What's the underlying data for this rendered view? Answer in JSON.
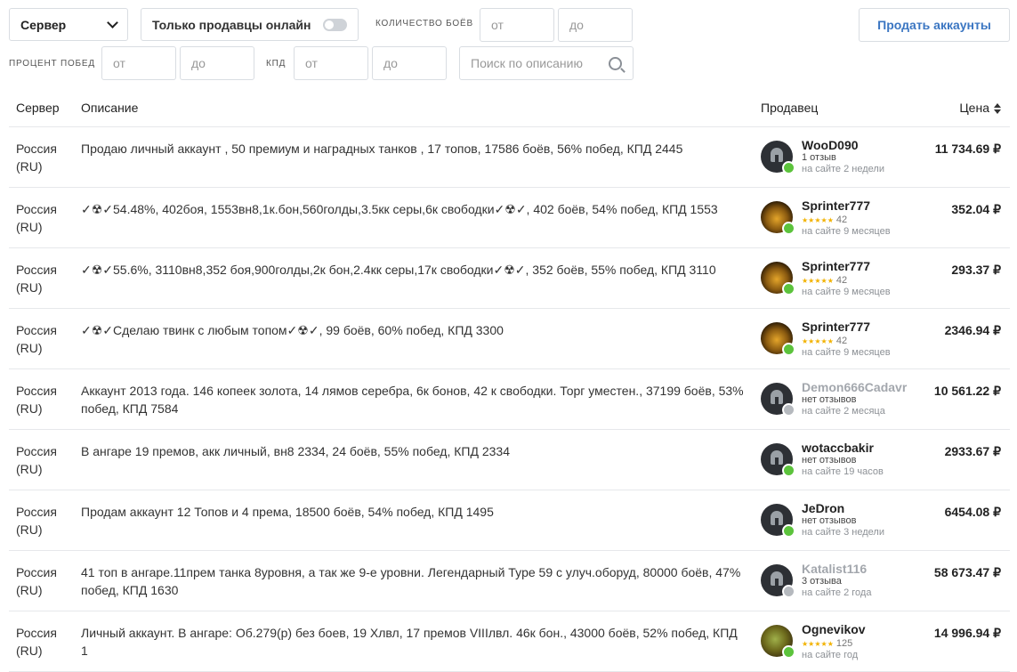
{
  "filters": {
    "server_select": "Сервер",
    "online_only": "Только продавцы онлайн",
    "battles_label": "КОЛИЧЕСТВО БОЁВ",
    "winrate_label": "ПРОЦЕНТ ПОБЕД",
    "kpd_label": "КПД",
    "from_placeholder": "от",
    "to_placeholder": "до",
    "search_placeholder": "Поиск по описанию",
    "sell_button": "Продать аккаунты"
  },
  "table": {
    "headers": {
      "server": "Сервер",
      "description": "Описание",
      "seller": "Продавец",
      "price": "Цена"
    },
    "rows": [
      {
        "server": "Россия (RU)",
        "description": "Продаю личный аккаунт , 50 премиум и наградных танков , 17 топов, 17586 боёв, 56% побед, КПД 2445",
        "seller": "WooD090",
        "reviews": "1 отзыв",
        "seen": "на сайте 2 недели",
        "price": "11 734.69 ₽"
      },
      {
        "server": "Россия (RU)",
        "description": "✓☢✓54.48%, 402боя, 1553вн8,1к.бон,560голды,3.5кк серы,6к свободки✓☢✓, 402 боёв, 54% побед, КПД 1553",
        "seller": "Sprinter777",
        "stars": "★★★★★",
        "rating": "42",
        "seen": "на сайте 9 месяцев",
        "price": "352.04 ₽"
      },
      {
        "server": "Россия (RU)",
        "description": "✓☢✓55.6%, 3110вн8,352 боя,900голды,2к бон,2.4кк серы,17к свободки✓☢✓, 352 боёв, 55% побед, КПД 3110",
        "seller": "Sprinter777",
        "stars": "★★★★★",
        "rating": "42",
        "seen": "на сайте 9 месяцев",
        "price": "293.37 ₽"
      },
      {
        "server": "Россия (RU)",
        "description": "✓☢✓Сделаю твинк с любым топом✓☢✓, 99 боёв, 60% побед, КПД 3300",
        "seller": "Sprinter777",
        "stars": "★★★★★",
        "rating": "42",
        "seen": "на сайте 9 месяцев",
        "price": "2346.94 ₽"
      },
      {
        "server": "Россия (RU)",
        "description": "Аккаунт 2013 года. 146 копеек золота, 14 лямов серебра, 6к бонов, 42 к свободки. Торг уместен., 37199 боёв, 53% побед, КПД 7584",
        "seller": "Demon666Cadavr",
        "reviews": "нет отзывов",
        "seen": "на сайте 2 месяца",
        "price": "10 561.22 ₽"
      },
      {
        "server": "Россия (RU)",
        "description": "В ангаре 19 премов, акк личный, вн8 2334, 24 боёв, 55% побед, КПД 2334",
        "seller": "wotaccbakir",
        "reviews": "нет отзывов",
        "seen": "на сайте 19 часов",
        "price": "2933.67 ₽"
      },
      {
        "server": "Россия (RU)",
        "description": "Продам аккаунт 12 Топов и 4 према, 18500 боёв, 54% побед, КПД 1495",
        "seller": "JeDron",
        "reviews": "нет отзывов",
        "seen": "на сайте 3 недели",
        "price": "6454.08 ₽"
      },
      {
        "server": "Россия (RU)",
        "description": "41 топ в ангаре.11прем танка 8уровня, а так же 9-е уровни. Легендарный Type 59 с улуч.оборуд, 80000 боёв, 47% побед, КПД 1630",
        "seller": "Katalist116",
        "reviews": "3 отзыва",
        "seen": "на сайте 2 года",
        "price": "58 673.47 ₽"
      },
      {
        "server": "Россия (RU)",
        "description": "Личный аккаунт. В ангаре: Об.279(р) без боев, 19 Хлвл, 17 премов VIIIлвл. 46к бон., 43000 боёв, 52% побед, КПД 1",
        "seller": "Ognevikov",
        "stars": "★★★★★",
        "rating": "125",
        "seen": "на сайте год",
        "price": "14 996.94 ₽"
      }
    ]
  }
}
